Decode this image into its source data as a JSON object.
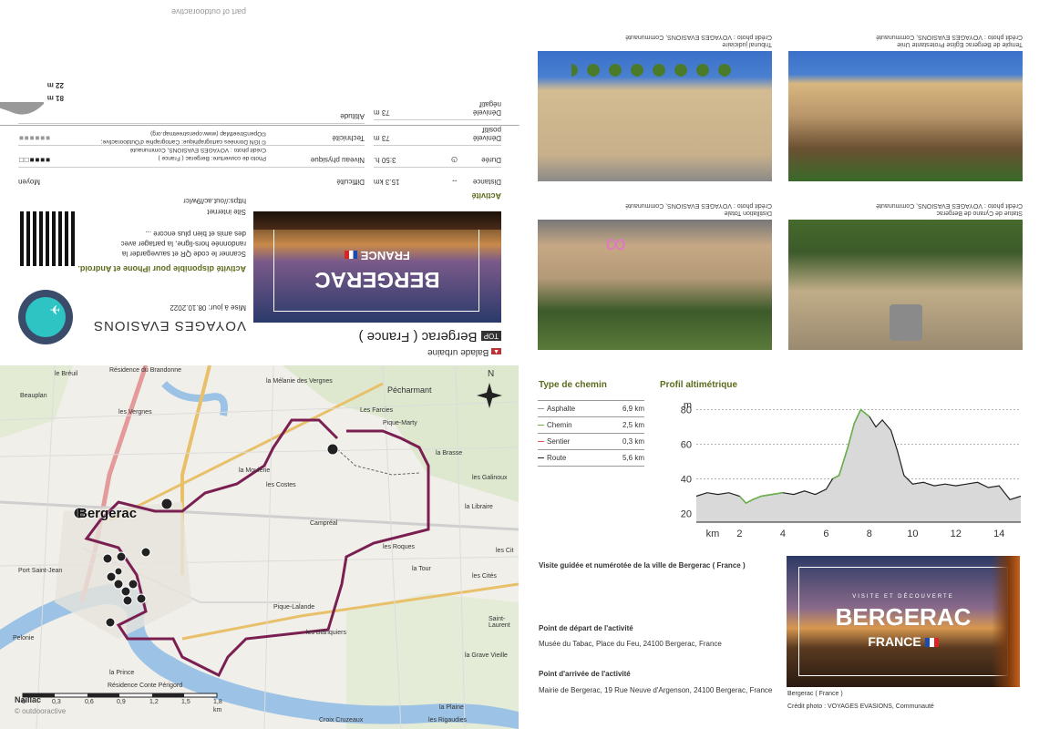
{
  "cover": {
    "brand": "part of outdooractive",
    "category": "Balade urbaine",
    "top_badge": "TOP",
    "title": "Bergerac ( France )",
    "org": "VOYAGES EVASIONS",
    "updated": "Mise à jour: 08.10.2022",
    "app_heading": "Activité disponible pour iPhone et Android.",
    "app_text1": "Scanner le code QR et sauvegarder la",
    "app_text2": "randonnée hors-ligne, la partager avec",
    "app_text3": "des amis et bien plus encore ...",
    "site_label": "Site internet",
    "site_url": "https://out.ac/l9wIcr",
    "credit1": "Photo de couverture: Bergerac ( France )",
    "credit2": "Crédit photo : VOYAGES EVASIONS, Communauté",
    "credit3": "© IGN Données cartographique: Cartographie d'Outdooractive;",
    "credit4": "©OpenStreetMap (www.openstreetmap.org)",
    "cover_city": "BERGERAC",
    "cover_country": "FRANCE",
    "stats_heading": "Activité",
    "distance_label": "Distance",
    "distance_value": "15.3 km",
    "duration_label": "Durée",
    "duration_value": "3:50 h.",
    "up_label1": "Dénivelé",
    "up_label2": "positif",
    "up_value": "73 m",
    "down_label1": "Dénivelé",
    "down_label2": "négatif",
    "down_value": "73 m",
    "difficulty_label": "Difficulté",
    "difficulty_value": "Moyen",
    "fitness_label": "Niveau physique",
    "technique_label": "Technicité",
    "altitude_label": "Altitude",
    "alt_max": "81 m",
    "alt_min": "22 m"
  },
  "photos": [
    {
      "caption": "Tribunal judiciaire",
      "credit": "Crédit photo : VOYAGES EVASIONS, Communauté"
    },
    {
      "caption": "Temple de Bergerac Eglise Protestante Unie",
      "credit": "Crédit photo : VOYAGES EVASIONS, Communauté"
    },
    {
      "caption": "Distillation Totale",
      "credit": "Crédit photo : VOYAGES EVASIONS, Communauté"
    },
    {
      "caption": "Statue de Cyrano de Bergerac",
      "credit": "Crédit photo : VOYAGES EVASIONS, Communauté"
    }
  ],
  "map": {
    "city": "Bergerac",
    "compass": "N",
    "labels": [
      "Pécharmant",
      "Les Farcies",
      "Pique-Marty",
      "la Brasse",
      "les Vergnes",
      "Beauplan",
      "le Bréuil",
      "la Moulerie",
      "les Costes",
      "les Galinoux",
      "la Libraire",
      "les Roques",
      "Campréal",
      "les Cités",
      "Pique-Lalande",
      "les Blanquiers",
      "la Tour",
      "les Cit",
      "Saint-Laurent",
      "Port Saint-Jean",
      "Pelonie",
      "la Prince",
      "la Plaine",
      "la Grave Vieille",
      "Résidence Conte Périgord",
      "Croix Cruzeaux",
      "les Rigaudies",
      "la Mélanie des Vergnes",
      "Résidence du Brandonne"
    ],
    "scale_labels": [
      "0",
      "0,3",
      "0,6",
      "0,9",
      "1,2",
      "1,5",
      "1,8"
    ],
    "scale_unit": "km",
    "watermark": "© outdooractive",
    "bottom_left": "Naillac"
  },
  "path_types": {
    "title": "Type de chemin",
    "rows": [
      {
        "name": "Asphalte",
        "value": "6,9 km",
        "color": "#999999"
      },
      {
        "name": "Chemin",
        "value": "2,5 km",
        "color": "#6ab04c"
      },
      {
        "name": "Sentier",
        "value": "0,3 km",
        "color": "#e05a4f"
      },
      {
        "name": "Route",
        "value": "5,6 km",
        "color": "#222222"
      }
    ]
  },
  "chart_data": {
    "type": "area",
    "title": "Profil altimétrique",
    "ylabel": "m",
    "xlabel": "km",
    "ylim": [
      15,
      85
    ],
    "xlim": [
      0,
      15
    ],
    "yticks": [
      20,
      40,
      60,
      80
    ],
    "xticks": [
      2,
      4,
      6,
      8,
      10,
      12,
      14
    ],
    "grid": true,
    "x": [
      0,
      0.5,
      1,
      1.5,
      2,
      2.3,
      2.6,
      3,
      3.5,
      4,
      4.5,
      5,
      5.5,
      6,
      6.3,
      6.6,
      7,
      7.3,
      7.6,
      8,
      8.3,
      8.6,
      9,
      9.3,
      9.6,
      10,
      10.5,
      11,
      11.5,
      12,
      12.5,
      13,
      13.5,
      14,
      14.5,
      15
    ],
    "y": [
      30,
      32,
      31,
      32,
      30,
      26,
      28,
      30,
      31,
      32,
      31,
      33,
      31,
      34,
      40,
      42,
      58,
      72,
      80,
      76,
      70,
      74,
      68,
      56,
      42,
      37,
      38,
      36,
      37,
      36,
      37,
      38,
      35,
      36,
      28,
      30
    ]
  },
  "info": {
    "heading": "Visite guidée et numérotée de la ville de Bergerac ( France )",
    "start_label": "Point de départ de l'activité",
    "start_value": "Musée du Tabac, Place du Feu, 24100 Bergerac, France",
    "end_label": "Point d'arrivée de l'activité",
    "end_value": "Mairie de Bergerac, 19 Rue Neuve d'Argenson, 24100 Bergerac, France",
    "photo_city": "BERGERAC",
    "photo_country": "FRANCE",
    "photo_subtitle": "VISITE ET DÉCOUVERTE",
    "photo_caption": "Bergerac ( France )",
    "photo_credit": "Crédit photo : VOYAGES EVASIONS, Communauté"
  },
  "colors": {
    "accent": "#5a6b1c",
    "route": "#7a1f52"
  }
}
